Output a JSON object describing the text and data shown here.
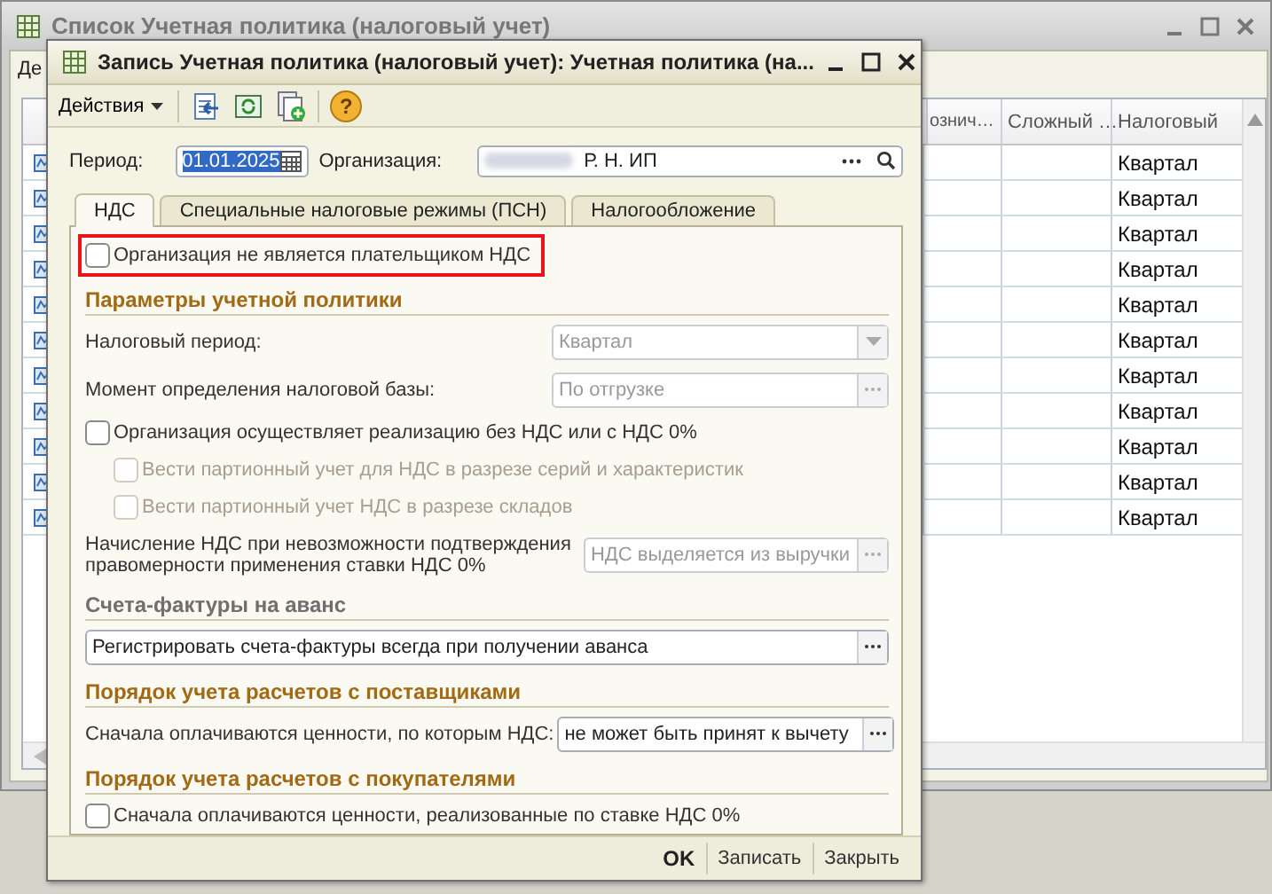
{
  "background_window": {
    "title": "Список Учетная политика (налоговый учет)",
    "menu_text": "Де",
    "table": {
      "columns": [
        "ознич…",
        "Сложный …",
        "Налоговый"
      ],
      "rows": [
        {
          "column_3": "Квартал"
        },
        {
          "column_3": "Квартал"
        },
        {
          "column_3": "Квартал"
        },
        {
          "column_3": "Квартал"
        },
        {
          "column_3": "Квартал"
        },
        {
          "column_3": "Квартал"
        },
        {
          "column_3": "Квартал"
        },
        {
          "column_3": "Квартал"
        },
        {
          "column_3": "Квартал"
        },
        {
          "column_3": "Квартал"
        },
        {
          "column_3": "Квартал"
        }
      ]
    }
  },
  "dialog": {
    "title": "Запись Учетная политика (налоговый учет): Учетная политика (на...",
    "toolbar": {
      "actions": "Действия",
      "help": "?"
    },
    "period": {
      "label": "Период:",
      "value": "01.01.2025",
      "selected": true
    },
    "organization": {
      "label": "Организация:",
      "value": "Р. Н. ИП"
    },
    "tabs": [
      {
        "label": "НДС",
        "selected": true
      },
      {
        "label": "Специальные налоговые режимы (ПСН)",
        "selected": false
      },
      {
        "label": "Налогообложение",
        "selected": false
      }
    ],
    "items": [
      {
        "kind": "checkbox",
        "label": "Организация не является плательщиком НДС",
        "checked": false,
        "disabled": false,
        "highlighted": true
      },
      {
        "kind": "heading",
        "label": "Параметры учетной политики",
        "color": "#a26a14"
      },
      {
        "kind": "select",
        "label": "Налоговый период:",
        "value": "Квартал",
        "disabled": true
      },
      {
        "kind": "field",
        "label": "Момент определения налоговой базы:",
        "value": "По отгрузке",
        "disabled": true
      },
      {
        "kind": "checkbox",
        "label": "Организация осуществляет реализацию без НДС или с НДС 0%",
        "checked": false,
        "disabled": false,
        "highlighted": false,
        "children": [
          {
            "label": "Вести партионный учет для НДС в разрезе серий и характеристик",
            "checked": false,
            "disabled": true
          },
          {
            "label": "Вести партионный учет НДС в разрезе складов",
            "checked": false,
            "disabled": true
          }
        ]
      },
      {
        "kind": "tall_field",
        "label": "Начисление НДС при невозможности подтверждения правомерности применения ставки НДС 0%",
        "value": "НДС выделяется из выручки",
        "disabled": true
      },
      {
        "kind": "heading",
        "label": "Счета-фактуры на аванс",
        "color": "#6f6f6f"
      },
      {
        "kind": "wide_field",
        "value": "Регистрировать счета-фактуры всегда при получении аванса",
        "disabled": false
      },
      {
        "kind": "heading",
        "label": "Порядок учета расчетов с поставщиками",
        "color": "#a26a14"
      },
      {
        "kind": "field",
        "label": "Сначала оплачиваются ценности, по которым НДС:",
        "value": "не может быть принят к вычету",
        "disabled": false
      },
      {
        "kind": "heading",
        "label": "Порядок учета расчетов с покупателями",
        "color": "#a26a14"
      },
      {
        "kind": "checkbox",
        "label": "Сначала оплачиваются ценности, реализованные по ставке НДС 0%",
        "checked": false,
        "disabled": false,
        "highlighted": false
      }
    ],
    "buttons": [
      {
        "label": "OK",
        "kind": "default"
      },
      {
        "label": "Записать",
        "kind": "normal"
      },
      {
        "label": "Закрыть",
        "kind": "normal"
      }
    ]
  }
}
